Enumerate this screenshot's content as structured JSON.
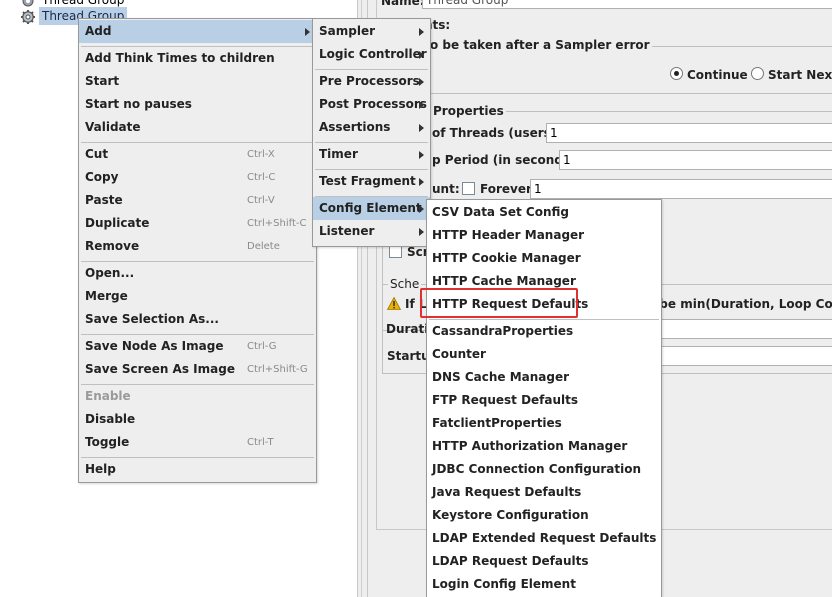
{
  "tree": {
    "items": [
      {
        "label": "Thread Group"
      },
      {
        "label": "Thread Group",
        "selected": true
      }
    ]
  },
  "right_panel": {
    "name_label": "Name:",
    "name_value": "Thread Group",
    "comments_fragment": "nts:",
    "sampler_error_fragment": "o be taken after a Sampler error",
    "radio_continue": "Continue",
    "radio_start_next": "Start Next T",
    "properties_fragment": "Properties",
    "threads_label_fragment": "of Threads (users):",
    "threads_value": "1",
    "ramp_label_fragment": "p Period (in seconds):",
    "ramp_value": "1",
    "loop_label_fragment": "unt:",
    "forever_label": "Forever",
    "loop_value": "1",
    "scheduler_checkbox_fragment": "Scr",
    "scheduler_group_fragment": "Sche",
    "warning_fragment_left": "If Lo",
    "warning_fragment_right": "l be min(Duration, Loop Count *",
    "duration_fragment": "Duratio",
    "startup_fragment": "Startup"
  },
  "menu_main": [
    {
      "label": "Add",
      "submenu": true,
      "highlighted": true
    },
    {
      "separator": true
    },
    {
      "label": "Add Think Times to children"
    },
    {
      "label": "Start"
    },
    {
      "label": "Start no pauses"
    },
    {
      "label": "Validate"
    },
    {
      "separator": true
    },
    {
      "label": "Cut",
      "shortcut": "Ctrl-X"
    },
    {
      "label": "Copy",
      "shortcut": "Ctrl-C"
    },
    {
      "label": "Paste",
      "shortcut": "Ctrl-V"
    },
    {
      "label": "Duplicate",
      "shortcut": "Ctrl+Shift-C"
    },
    {
      "label": "Remove",
      "shortcut": "Delete"
    },
    {
      "separator": true
    },
    {
      "label": "Open..."
    },
    {
      "label": "Merge"
    },
    {
      "label": "Save Selection As..."
    },
    {
      "separator": true
    },
    {
      "label": "Save Node As Image",
      "shortcut": "Ctrl-G"
    },
    {
      "label": "Save Screen As Image",
      "shortcut": "Ctrl+Shift-G"
    },
    {
      "separator": true
    },
    {
      "label": "Enable",
      "disabled": true
    },
    {
      "label": "Disable"
    },
    {
      "label": "Toggle",
      "shortcut": "Ctrl-T"
    },
    {
      "separator": true
    },
    {
      "label": "Help"
    }
  ],
  "menu_add": [
    {
      "label": "Sampler",
      "submenu": true
    },
    {
      "label": "Logic Controller",
      "submenu": true
    },
    {
      "separator": true
    },
    {
      "label": "Pre Processors",
      "submenu": true
    },
    {
      "label": "Post Processors",
      "submenu": true
    },
    {
      "label": "Assertions",
      "submenu": true
    },
    {
      "separator": true
    },
    {
      "label": "Timer",
      "submenu": true
    },
    {
      "separator": true
    },
    {
      "label": "Test Fragment",
      "submenu": true
    },
    {
      "separator": true
    },
    {
      "label": "Config Element",
      "submenu": true,
      "highlighted": true
    },
    {
      "label": "Listener",
      "submenu": true
    }
  ],
  "menu_config": [
    {
      "label": "CSV Data Set Config"
    },
    {
      "label": "HTTP Header Manager"
    },
    {
      "label": "HTTP Cookie Manager"
    },
    {
      "label": "HTTP Cache Manager"
    },
    {
      "label": "HTTP Request Defaults",
      "annotated": true
    },
    {
      "separator": true
    },
    {
      "label": "CassandraProperties"
    },
    {
      "label": "Counter"
    },
    {
      "label": "DNS Cache Manager"
    },
    {
      "label": "FTP Request Defaults"
    },
    {
      "label": "FatclientProperties"
    },
    {
      "label": "HTTP Authorization Manager"
    },
    {
      "label": "JDBC Connection Configuration"
    },
    {
      "label": "Java Request Defaults"
    },
    {
      "label": "Keystore Configuration"
    },
    {
      "label": "LDAP Extended Request Defaults"
    },
    {
      "label": "LDAP Request Defaults"
    },
    {
      "label": "Login Config Element"
    }
  ],
  "colors": {
    "highlight": "#b8cfe5",
    "annotation": "#e03030",
    "menu_bg": "#eeeeee",
    "warning": "#e8b400"
  }
}
